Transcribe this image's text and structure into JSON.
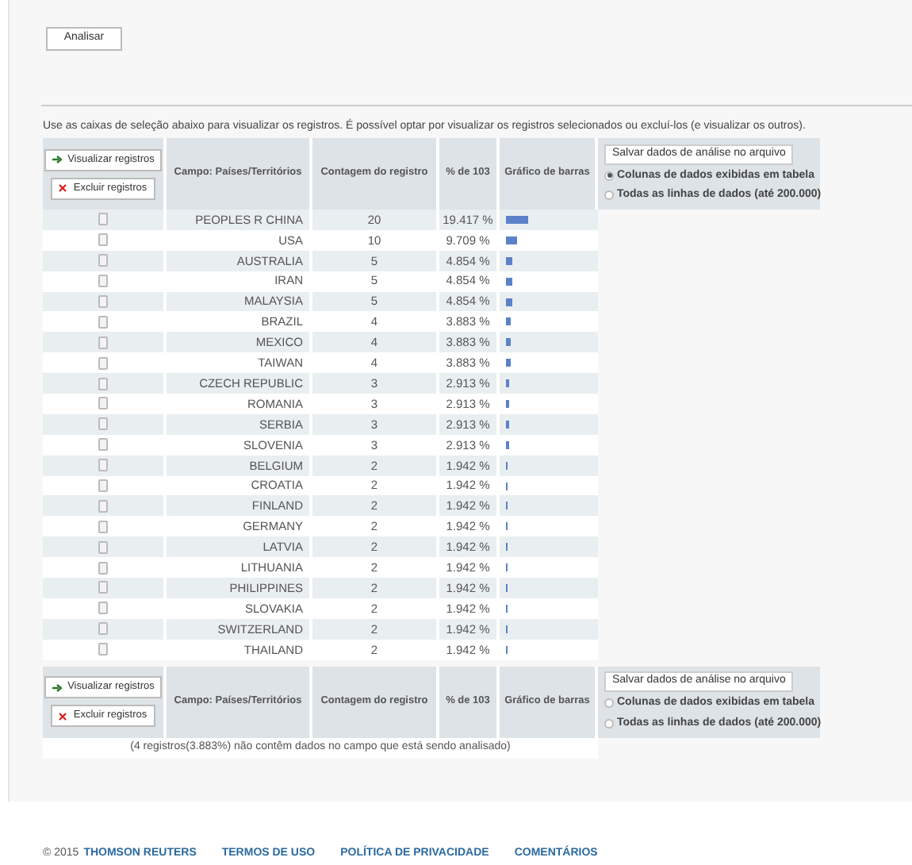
{
  "analyze_button": "Analisar",
  "instructions": "Use as caixas de seleção abaixo para visualizar os registros. É possível optar por visualizar os registros selecionados ou excluí-los (e visualizar os outros).",
  "header_top": {
    "view_button": "Visualizar registros",
    "exclude_button": "Excluir registros",
    "columns": [
      "Campo: Países/Territórios",
      "Contagem do registro",
      "% de 103",
      "Gráfico de barras"
    ],
    "save_button": "Salvar dados de análise no arquivo",
    "options": [
      {
        "label": "Colunas de dados exibidas em tabela",
        "selected": true
      },
      {
        "label": "Todas as linhas de dados (até 200.000)",
        "selected": false
      }
    ]
  },
  "rows": [
    {
      "name": "PEOPLES R CHINA",
      "count": "20",
      "percent": "19.417 %",
      "checked": false
    },
    {
      "name": "USA",
      "count": "10",
      "percent": "9.709 %",
      "checked": false
    },
    {
      "name": "AUSTRALIA",
      "count": "5",
      "percent": "4.854 %",
      "checked": false
    },
    {
      "name": "IRAN",
      "count": "5",
      "percent": "4.854 %",
      "checked": false
    },
    {
      "name": "MALAYSIA",
      "count": "5",
      "percent": "4.854 %",
      "checked": false
    },
    {
      "name": "BRAZIL",
      "count": "4",
      "percent": "3.883 %",
      "checked": false
    },
    {
      "name": "MEXICO",
      "count": "4",
      "percent": "3.883 %",
      "checked": false
    },
    {
      "name": "TAIWAN",
      "count": "4",
      "percent": "3.883 %",
      "checked": false
    },
    {
      "name": "CZECH REPUBLIC",
      "count": "3",
      "percent": "2.913 %",
      "checked": false
    },
    {
      "name": "ROMANIA",
      "count": "3",
      "percent": "2.913 %",
      "checked": false
    },
    {
      "name": "SERBIA",
      "count": "3",
      "percent": "2.913 %",
      "checked": false
    },
    {
      "name": "SLOVENIA",
      "count": "3",
      "percent": "2.913 %",
      "checked": false
    },
    {
      "name": "BELGIUM",
      "count": "2",
      "percent": "1.942 %",
      "checked": false
    },
    {
      "name": "CROATIA",
      "count": "2",
      "percent": "1.942 %",
      "checked": false
    },
    {
      "name": "FINLAND",
      "count": "2",
      "percent": "1.942 %",
      "checked": false
    },
    {
      "name": "GERMANY",
      "count": "2",
      "percent": "1.942 %",
      "checked": false
    },
    {
      "name": "LATVIA",
      "count": "2",
      "percent": "1.942 %",
      "checked": false
    },
    {
      "name": "LITHUANIA",
      "count": "2",
      "percent": "1.942 %",
      "checked": false
    },
    {
      "name": "PHILIPPINES",
      "count": "2",
      "percent": "1.942 %",
      "checked": false
    },
    {
      "name": "SLOVAKIA",
      "count": "2",
      "percent": "1.942 %",
      "checked": false
    },
    {
      "name": "SWITZERLAND",
      "count": "2",
      "percent": "1.942 %",
      "checked": false
    },
    {
      "name": "THAILAND",
      "count": "2",
      "percent": "1.942 %",
      "checked": false
    }
  ],
  "header_bottom": {
    "view_button": "Visualizar registros",
    "exclude_button": "Excluir registros",
    "columns": [
      "Campo: Países/Territórios",
      "Contagem do registro",
      "% de 103",
      "Gráfico de barras"
    ],
    "save_button": "Salvar dados de análise no arquivo",
    "options": [
      {
        "label": "Colunas de dados exibidas em tabela",
        "selected": false
      },
      {
        "label": "Todas as linhas de dados (até 200.000)",
        "selected": false
      }
    ]
  },
  "note": "(4 registros(3.883%) não contêm dados no campo que está sendo analisado)",
  "footer": {
    "copyright": "© 2015",
    "links": [
      "THOMSON REUTERS",
      "TERMOS DE USO",
      "POLÍTICA DE PRIVACIDADE",
      "COMENTÁRIOS"
    ]
  }
}
